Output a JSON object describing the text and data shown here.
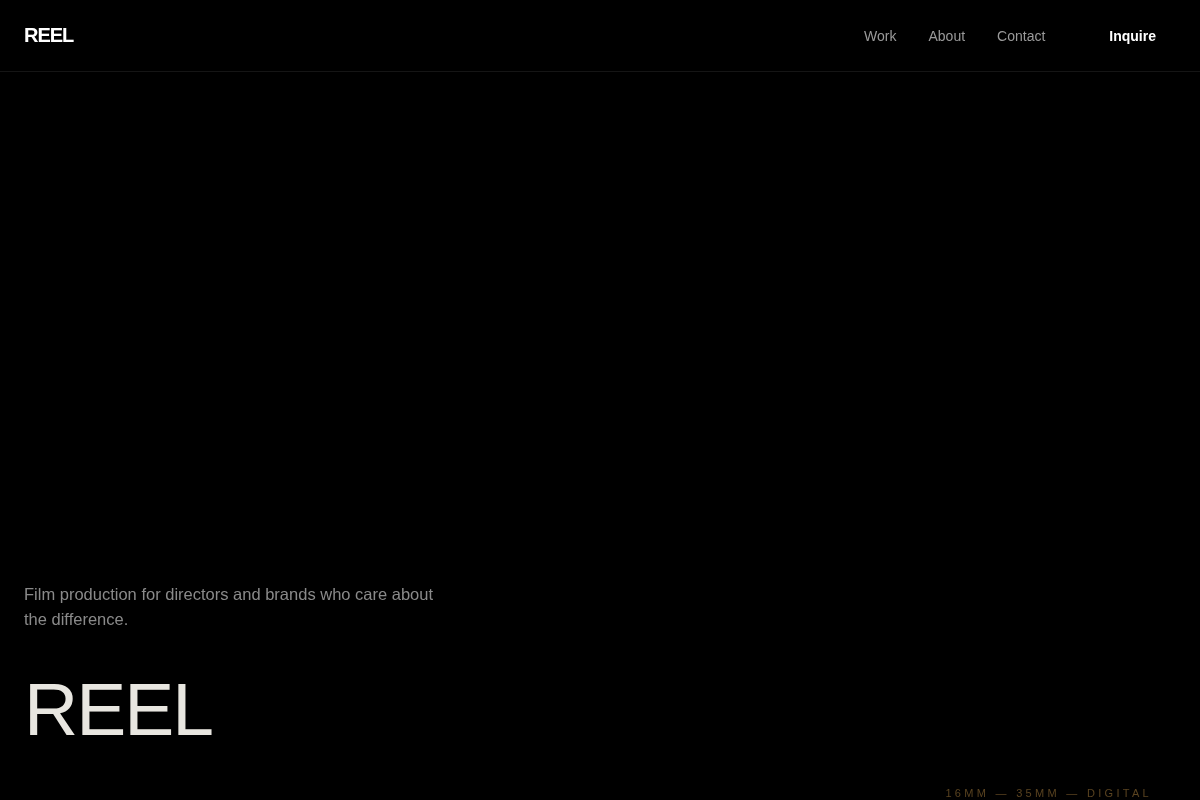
{
  "header": {
    "logo": "REEL",
    "nav": [
      "Work",
      "About",
      "Contact"
    ],
    "cta": "Inquire"
  },
  "hero": {
    "tagline": "Film production for directors and brands who care about the difference.",
    "title": "REEL",
    "formats": "16MM — 35MM — DIGITAL"
  }
}
